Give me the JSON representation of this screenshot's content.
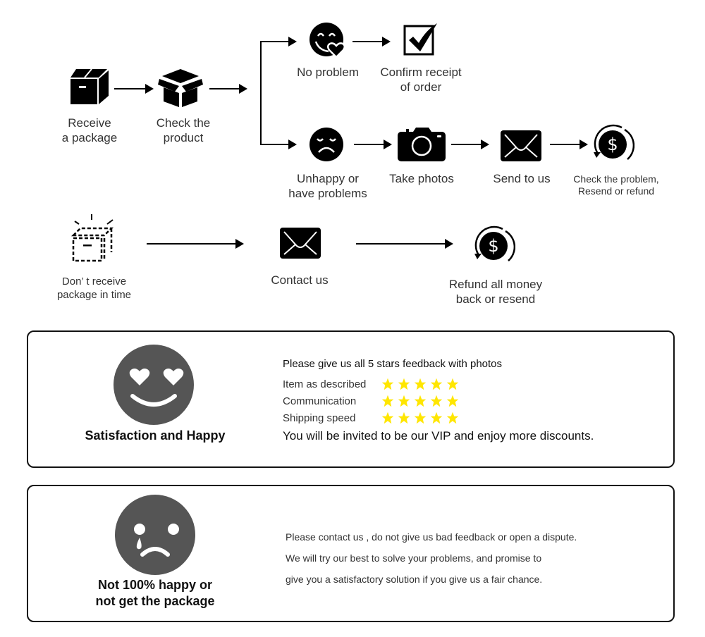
{
  "flow_top": {
    "receive": {
      "label_line1": "Receive",
      "label_line2": "a package",
      "icon": "closed-box-icon"
    },
    "check": {
      "label_line1": "Check the",
      "label_line2": "product",
      "icon": "open-box-icon"
    },
    "no_problem": {
      "label": "No problem",
      "icon": "happy-heart-face-icon"
    },
    "confirm": {
      "label_line1": "Confirm receipt",
      "label_line2": "of order",
      "icon": "checkbox-checked-icon"
    },
    "unhappy": {
      "label_line1": "Unhappy or",
      "label_line2": "have problems",
      "icon": "sad-face-icon"
    },
    "photos": {
      "label": "Take photos",
      "icon": "camera-icon"
    },
    "send": {
      "label": "Send to us",
      "icon": "envelope-icon"
    },
    "resolve": {
      "label_line1": "Check the problem,",
      "label_line2": "Resend or refund",
      "icon": "dollar-refund-icon"
    }
  },
  "flow_bottom": {
    "not_received": {
      "label_line1": "Don’ t receive",
      "label_line2": "package in time",
      "icon": "dashed-box-icon"
    },
    "contact": {
      "label": "Contact us",
      "icon": "envelope-icon"
    },
    "refund": {
      "label_line1": "Refund all money",
      "label_line2": "back or resend",
      "icon": "dollar-refund-icon"
    }
  },
  "happy_panel": {
    "title": "Satisfaction and Happy",
    "icon": "heart-eyes-face-icon",
    "face_color": "#555555",
    "heading": "Please give us all 5 stars feedback with photos",
    "ratings": [
      {
        "label": "Item as described",
        "stars": 5,
        "max": 5
      },
      {
        "label": "Communication",
        "stars": 5,
        "max": 5
      },
      {
        "label": "Shipping speed",
        "stars": 5,
        "max": 5
      }
    ],
    "star_color": "#FFE600",
    "vip_text": "You will be invited to be our VIP and enjoy more discounts."
  },
  "sad_panel": {
    "title_line1": "Not 100% happy or",
    "title_line2": "not get the package",
    "icon": "crying-face-icon",
    "face_color": "#555555",
    "lines": [
      "Please contact us , do not give us bad feedback or open a dispute.",
      "We will try our best to solve your problems, and promise to",
      "give you a satisfactory solution if you give us a fair chance."
    ]
  }
}
